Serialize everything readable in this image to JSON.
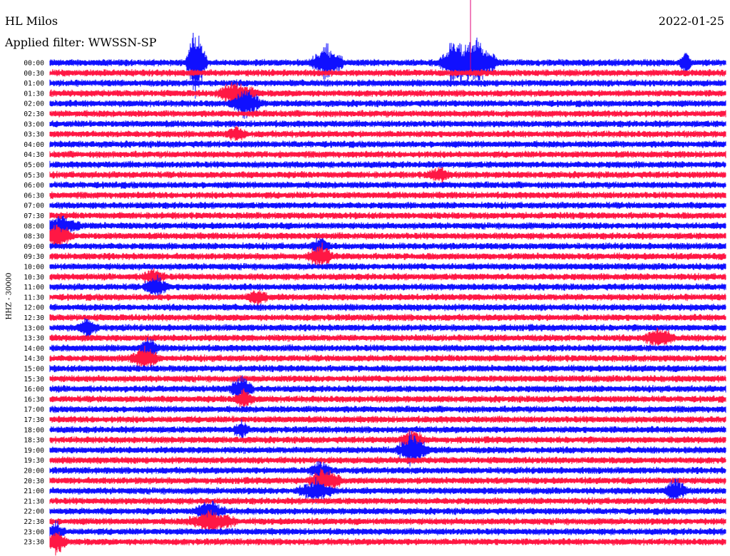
{
  "header": {
    "station": "HL Milos",
    "filter": "Applied filter: WWSSN-SP",
    "date": "2022-01-25"
  },
  "channel": "HHZ - 30000",
  "colors": {
    "trace_a": "#1010ff",
    "trace_b": "#ff1744",
    "event_marker": "#e0007a"
  },
  "chart_data": {
    "type": "line",
    "title": "HL Milos",
    "subtitle": "Applied filter: WWSSN-SP",
    "date": "2022-01-25",
    "ylabel": "HHZ - 30000",
    "row_labels": [
      "00:00",
      "00:30",
      "01:00",
      "01:30",
      "02:00",
      "02:30",
      "03:00",
      "03:30",
      "04:00",
      "04:30",
      "05:00",
      "05:30",
      "06:00",
      "06:30",
      "07:00",
      "07:30",
      "08:00",
      "08:30",
      "09:00",
      "09:30",
      "10:00",
      "10:30",
      "11:00",
      "11:30",
      "12:00",
      "12:30",
      "13:00",
      "13:30",
      "14:00",
      "14:30",
      "15:00",
      "15:30",
      "16:00",
      "16:30",
      "17:00",
      "17:30",
      "18:00",
      "18:30",
      "19:00",
      "19:30",
      "20:00",
      "20:30",
      "21:00",
      "21:30",
      "22:00",
      "22:30",
      "23:00",
      "23:30"
    ],
    "row_duration_minutes": 30,
    "series_colors_alternating": [
      "blue",
      "red"
    ],
    "bursts": [
      {
        "row": 0,
        "minute": 6.5,
        "amp": 6.0,
        "width": 0.5
      },
      {
        "row": 0,
        "minute": 12.3,
        "amp": 3.0,
        "width": 0.8
      },
      {
        "row": 0,
        "minute": 17.8,
        "amp": 2.5,
        "width": 0.6
      },
      {
        "row": 0,
        "minute": 18.8,
        "amp": 4.0,
        "width": 1.2
      },
      {
        "row": 0,
        "minute": 28.2,
        "amp": 2.0,
        "width": 0.3
      },
      {
        "row": 3,
        "minute": 8.3,
        "amp": 1.8,
        "width": 1.0
      },
      {
        "row": 4,
        "minute": 8.7,
        "amp": 2.2,
        "width": 0.8
      },
      {
        "row": 7,
        "minute": 8.3,
        "amp": 1.2,
        "width": 0.5
      },
      {
        "row": 11,
        "minute": 17.3,
        "amp": 1.0,
        "width": 0.6
      },
      {
        "row": 16,
        "minute": 0.5,
        "amp": 1.5,
        "width": 1.0
      },
      {
        "row": 17,
        "minute": 0.3,
        "amp": 2.0,
        "width": 0.8
      },
      {
        "row": 18,
        "minute": 12.0,
        "amp": 1.3,
        "width": 0.5
      },
      {
        "row": 19,
        "minute": 12.0,
        "amp": 1.8,
        "width": 0.6
      },
      {
        "row": 21,
        "minute": 4.6,
        "amp": 1.2,
        "width": 0.6
      },
      {
        "row": 22,
        "minute": 4.7,
        "amp": 1.8,
        "width": 0.6
      },
      {
        "row": 23,
        "minute": 9.2,
        "amp": 1.3,
        "width": 0.5
      },
      {
        "row": 26,
        "minute": 1.7,
        "amp": 1.5,
        "width": 0.5
      },
      {
        "row": 27,
        "minute": 27.0,
        "amp": 1.5,
        "width": 0.8
      },
      {
        "row": 28,
        "minute": 4.4,
        "amp": 1.5,
        "width": 0.5
      },
      {
        "row": 29,
        "minute": 4.2,
        "amp": 1.5,
        "width": 0.8
      },
      {
        "row": 32,
        "minute": 8.5,
        "amp": 2.0,
        "width": 0.6
      },
      {
        "row": 33,
        "minute": 8.6,
        "amp": 1.5,
        "width": 0.5
      },
      {
        "row": 36,
        "minute": 8.5,
        "amp": 1.5,
        "width": 0.4
      },
      {
        "row": 37,
        "minute": 16.1,
        "amp": 1.8,
        "width": 0.6
      },
      {
        "row": 38,
        "minute": 16.1,
        "amp": 2.6,
        "width": 0.8
      },
      {
        "row": 40,
        "minute": 12.0,
        "amp": 1.3,
        "width": 0.6
      },
      {
        "row": 41,
        "minute": 12.2,
        "amp": 2.2,
        "width": 0.8
      },
      {
        "row": 42,
        "minute": 11.8,
        "amp": 1.5,
        "width": 1.0
      },
      {
        "row": 42,
        "minute": 27.8,
        "amp": 1.8,
        "width": 0.6
      },
      {
        "row": 44,
        "minute": 7.1,
        "amp": 1.5,
        "width": 0.8
      },
      {
        "row": 45,
        "minute": 7.2,
        "amp": 1.6,
        "width": 1.2
      },
      {
        "row": 46,
        "minute": 0.3,
        "amp": 1.5,
        "width": 0.4
      },
      {
        "row": 47,
        "minute": 0.3,
        "amp": 2.0,
        "width": 0.5
      }
    ]
  }
}
